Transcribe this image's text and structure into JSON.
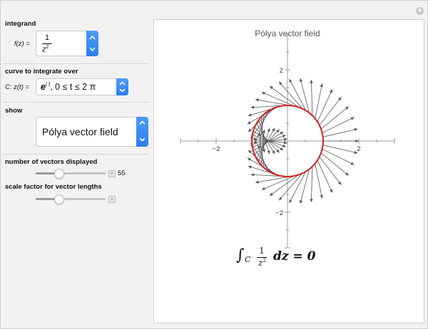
{
  "controls": {
    "integrand": {
      "label": "integrand",
      "var_label": "f(z) =",
      "numerator": "1",
      "denominator_base": "z",
      "denominator_exp": "2"
    },
    "curve": {
      "label": "curve to integrate over",
      "var_label": "C: z(t) =",
      "expr_base": "e",
      "expr_sup": "i t",
      "expr_rest": ", 0 ≤ t ≤ 2 π"
    },
    "show": {
      "label": "show",
      "selected": "Pólya vector field"
    },
    "num_vectors": {
      "label": "number of vectors displayed",
      "value": "55",
      "fraction": 0.33
    },
    "scale_factor": {
      "label": "scale factor for vector lengths",
      "fraction": 0.33
    }
  },
  "chart_data": {
    "type": "vector-field",
    "title": "Pólya vector field",
    "x_ticks": [
      "−2",
      "2"
    ],
    "y_ticks": [
      "2",
      "−2"
    ],
    "xlim": [
      -3,
      3
    ],
    "ylim": [
      -3,
      3
    ],
    "curve": "unit circle",
    "curve_color": "#d62020",
    "arrow_color": "#555555",
    "vector_count": 55,
    "field": "conj(1/z^2)",
    "result": {
      "integral": "∫",
      "sub": "C",
      "num": "1",
      "den": "z",
      "den_exp": "2",
      "rest": "dz = 0"
    }
  }
}
